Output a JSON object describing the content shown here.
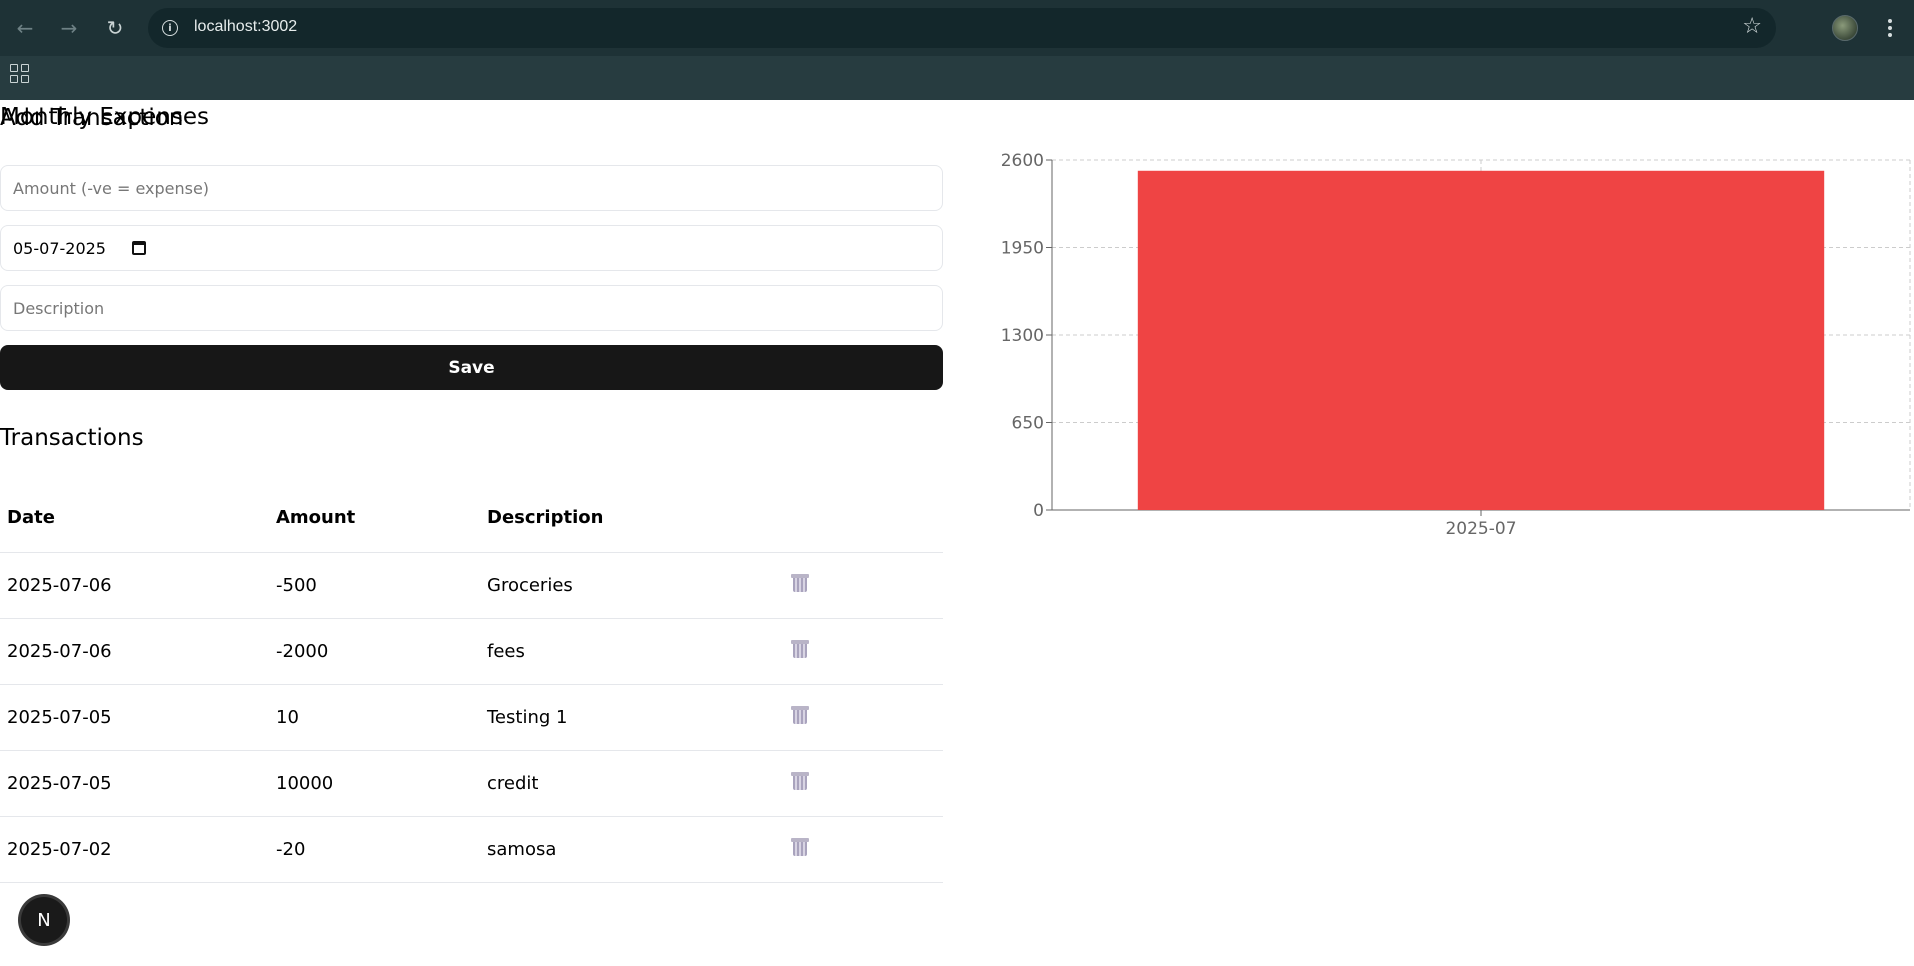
{
  "browser": {
    "url": "localhost:3002",
    "back_icon": "arrow-left-icon",
    "forward_icon": "arrow-right-icon",
    "reload_icon": "reload-icon",
    "star_icon": "star-icon",
    "menu_icon": "more-vert-icon",
    "apps_icon": "apps-grid-icon"
  },
  "form": {
    "title": "Add Transaction",
    "amount_placeholder": "Amount (-ve = expense)",
    "amount_value": "",
    "date_value": "05-07-2025",
    "description_placeholder": "Description",
    "description_value": "",
    "save_label": "Save"
  },
  "transactions": {
    "title": "Transactions",
    "columns": [
      "Date",
      "Amount",
      "Description",
      ""
    ],
    "rows": [
      {
        "date": "2025-07-06",
        "amount": "-500",
        "description": "Groceries"
      },
      {
        "date": "2025-07-06",
        "amount": "-2000",
        "description": "fees"
      },
      {
        "date": "2025-07-05",
        "amount": "10",
        "description": "Testing 1"
      },
      {
        "date": "2025-07-05",
        "amount": "10000",
        "description": "credit"
      },
      {
        "date": "2025-07-02",
        "amount": "-20",
        "description": "samosa"
      }
    ]
  },
  "chart_section": {
    "title": "Monthly Expenses"
  },
  "chart_data": {
    "type": "bar",
    "title": "Monthly Expenses",
    "categories": [
      "2025-07"
    ],
    "values": [
      2520
    ],
    "yticks": [
      0,
      650,
      1300,
      1950,
      2600
    ],
    "ylim": [
      0,
      2600
    ],
    "xlabel": "",
    "ylabel": "",
    "grid": true,
    "bar_color": "#ef4444"
  },
  "badge": {
    "label": "N"
  }
}
